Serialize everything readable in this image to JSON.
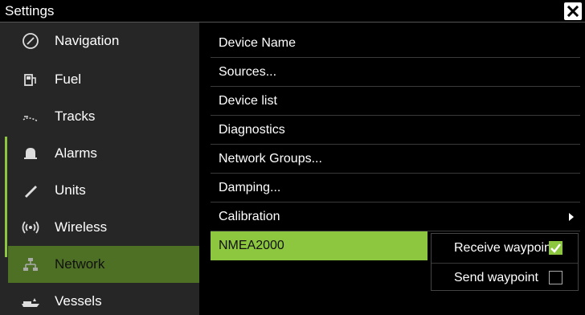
{
  "window": {
    "title": "Settings",
    "close_icon": "close-icon"
  },
  "sidebar": {
    "items": [
      {
        "label": "Navigation",
        "icon": "compass-icon",
        "selected": false
      },
      {
        "label": "Fuel",
        "icon": "fuel-icon",
        "selected": false
      },
      {
        "label": "Tracks",
        "icon": "tracks-icon",
        "selected": false
      },
      {
        "label": "Alarms",
        "icon": "bell-icon",
        "selected": false
      },
      {
        "label": "Units",
        "icon": "ruler-icon",
        "selected": false
      },
      {
        "label": "Wireless",
        "icon": "wireless-icon",
        "selected": false
      },
      {
        "label": "Network",
        "icon": "network-icon",
        "selected": true
      },
      {
        "label": "Vessels",
        "icon": "vessel-icon",
        "selected": false
      }
    ]
  },
  "main": {
    "items": [
      {
        "label": "Device Name"
      },
      {
        "label": "Sources..."
      },
      {
        "label": "Device list"
      },
      {
        "label": "Diagnostics"
      },
      {
        "label": "Network Groups..."
      },
      {
        "label": "Damping..."
      },
      {
        "label": "Calibration",
        "has_submenu": true
      },
      {
        "label": "NMEA2000",
        "highlighted": true
      }
    ]
  },
  "submenu": {
    "items": [
      {
        "label": "Receive waypoint",
        "checked": true
      },
      {
        "label": "Send waypoint",
        "checked": false
      }
    ]
  },
  "colors": {
    "accent": "#8dc63f",
    "selected_bg": "#4e7024",
    "sidebar_bg": "#262626",
    "background": "#000000"
  }
}
